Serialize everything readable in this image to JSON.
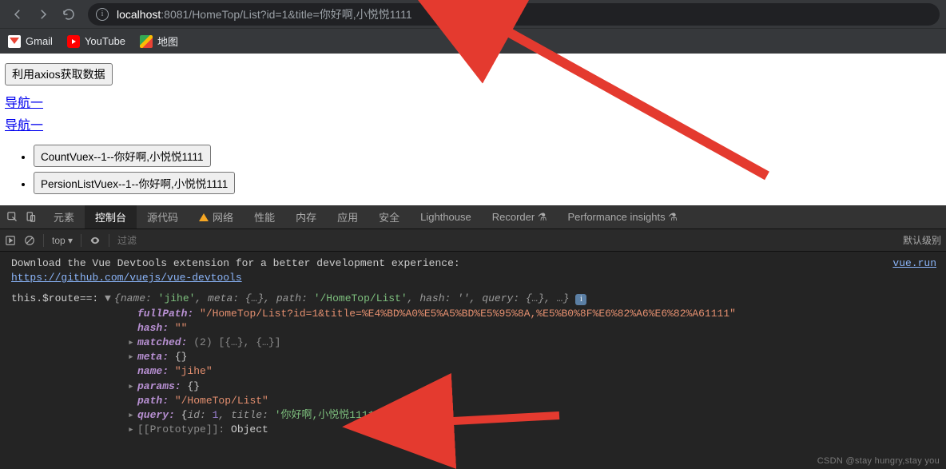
{
  "browser": {
    "url_host": "localhost",
    "url_rest": ":8081/HomeTop/List?id=1&title=你好啊,小悦悦1111"
  },
  "bookmarks": [
    {
      "label": "Gmail",
      "icon": "gmail-icon"
    },
    {
      "label": "YouTube",
      "icon": "youtube-icon"
    },
    {
      "label": "地图",
      "icon": "maps-icon"
    }
  ],
  "page": {
    "fetch_button": "利用axios获取数据",
    "nav_links": [
      "导航一",
      "导航一"
    ],
    "list_buttons": [
      "CountVuex--1--你好啊,小悦悦1111",
      "PersionListVuex--1--你好啊,小悦悦1111"
    ]
  },
  "devtools": {
    "tabs": [
      "元素",
      "控制台",
      "源代码",
      "网络",
      "性能",
      "内存",
      "应用",
      "安全",
      "Lighthouse",
      "Recorder ⚗",
      "Performance insights ⚗"
    ],
    "active_tab": "控制台",
    "top_label": "top ▾",
    "filter_placeholder": "过滤",
    "level_label": "默认级别",
    "msg_download": "Download the Vue Devtools extension for a better development experience:",
    "msg_download_link": "https://github.com/vuejs/vue-devtools",
    "source_link": "vue.run",
    "route_prefix": "this.$route==: ",
    "route_summary_prefix": "{name: ",
    "route_summary_name": "'jihe'",
    "route_summary_mid1": ", meta: {…}, path: ",
    "route_summary_path": "'/HomeTop/List'",
    "route_summary_mid2": ", hash: '', query: {…}, …}",
    "fullPath_key": "fullPath:",
    "fullPath_val": "\"/HomeTop/List?id=1&title=%E4%BD%A0%E5%A5%BD%E5%95%8A,%E5%B0%8F%E6%82%A6%E6%82%A61111\"",
    "hash_key": "hash:",
    "hash_val": "\"\"",
    "matched_key": "matched:",
    "matched_val": "(2) [{…}, {…}]",
    "meta_key": "meta:",
    "meta_val": "{}",
    "name_key": "name:",
    "name_val": "\"jihe\"",
    "params_key": "params:",
    "params_val": "{}",
    "path_key": "path:",
    "path_val": "\"/HomeTop/List\"",
    "query_key": "query:",
    "query_open": "{",
    "query_id_key": "id:",
    "query_id_val": "1",
    "query_sep": ", ",
    "query_title_key": "title:",
    "query_title_val": "'你好啊,小悦悦1111'",
    "query_close": "}",
    "proto_key": "[[Prototype]]:",
    "proto_val": "Object"
  },
  "watermark": "CSDN @stay hungry,stay you"
}
